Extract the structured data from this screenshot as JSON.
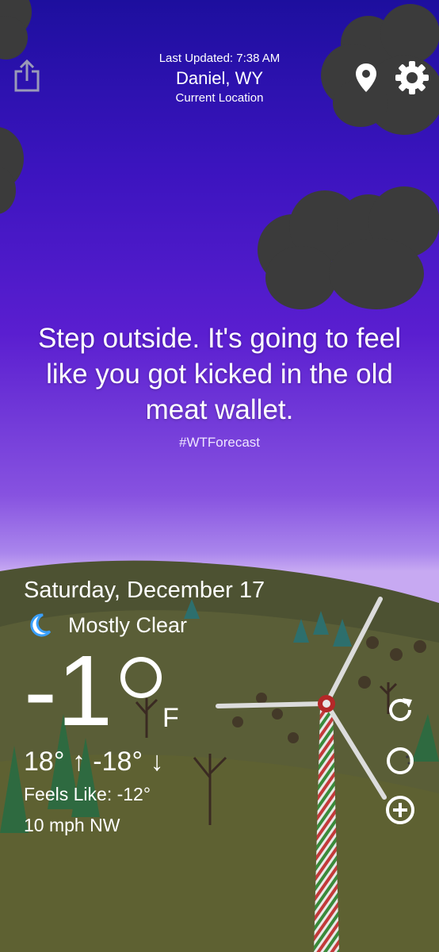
{
  "header": {
    "last_updated": "Last Updated: 7:38 AM",
    "city": "Daniel, WY",
    "location_label": "Current Location"
  },
  "forecast": {
    "message": "Step outside. It's going to feel like you got kicked in the old meat wallet.",
    "hashtag": "#WTForecast"
  },
  "weather": {
    "date": "Saturday, December 17",
    "condition": "Mostly Clear",
    "condition_icon": "moon-icon",
    "temperature": "-1",
    "unit": "F",
    "hilo": "18° ↑  -18° ↓",
    "feels_like": "Feels Like: -12°",
    "wind": "10 mph NW"
  },
  "icons": {
    "share": "share-icon",
    "location": "location-pin-icon",
    "settings": "gear-icon",
    "refresh": "refresh-icon",
    "moon_phase": "moon-phase-icon",
    "add": "add-icon"
  },
  "colors": {
    "sky_top": "#1d0f9e",
    "sky_bottom": "#c7a9f2",
    "cloud": "#3b3b3b",
    "hills": "#4a5230",
    "moon": "#3aa0ff"
  }
}
